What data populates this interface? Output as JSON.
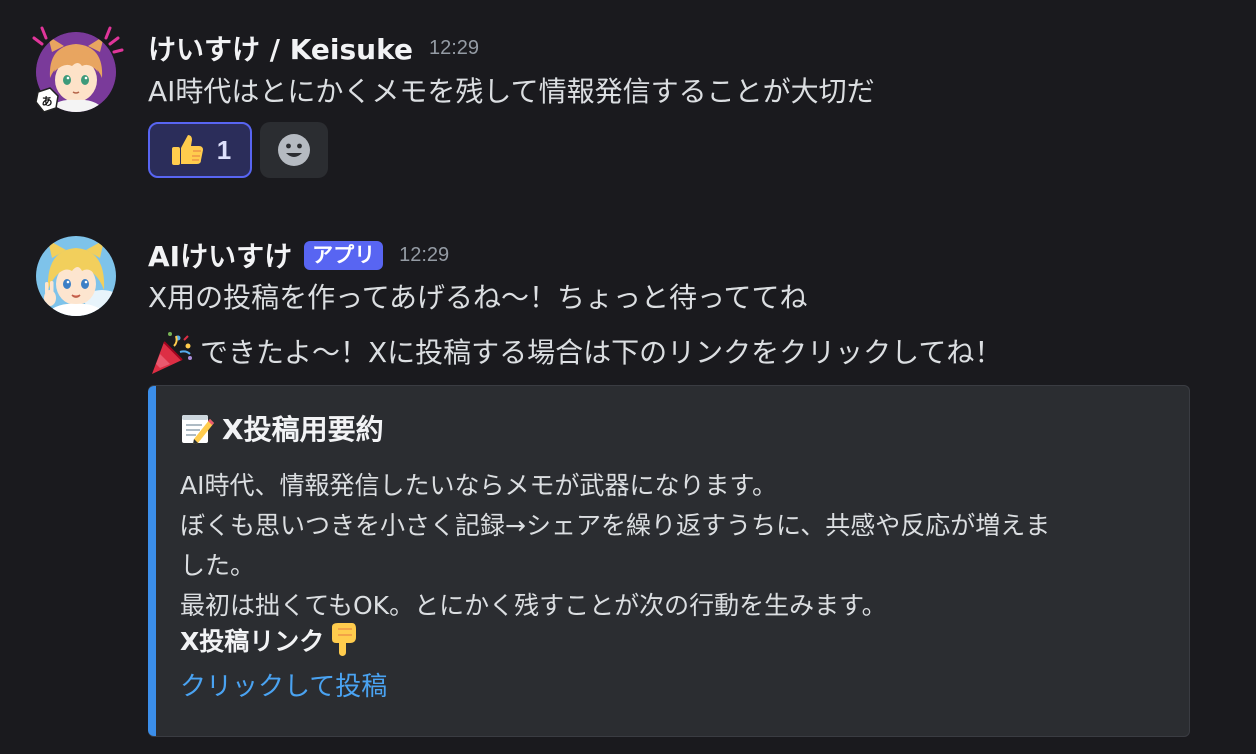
{
  "messages": [
    {
      "username": "けいすけ / Keisuke",
      "timestamp": "12:29",
      "text": "AI時代はとにかくメモを残して情報発信することが大切だ",
      "reactions": [
        {
          "emoji": "thumbs-up-icon",
          "count": "1"
        },
        {
          "emoji": "add-reaction-icon"
        }
      ]
    },
    {
      "username": "AIけいすけ",
      "badge": "アプリ",
      "timestamp": "12:29",
      "lines": [
        "X用の投稿を作ってあげるね〜！ちょっと待っててね",
        "できたよ〜！Xに投稿する場合は下のリンクをクリックしてね！"
      ],
      "embed": {
        "title": "X投稿用要約",
        "description": [
          "AI時代、情報発信したいならメモが武器になります。",
          "ぼくも思いつきを小さく記録→シェアを繰り返すうちに、共感や反応が増えま",
          "した。",
          "最初は拙くてもOK。とにかく残すことが次の行動を生みます。"
        ],
        "field_name": "X投稿リンク",
        "link_text": "クリックして投稿"
      }
    }
  ],
  "colors": {
    "background": "#1a1a1e",
    "app_badge": "#5865f2",
    "embed_bar": "#3b8eea",
    "link": "#4aa3f2",
    "reaction_active_border": "#5865f2"
  }
}
